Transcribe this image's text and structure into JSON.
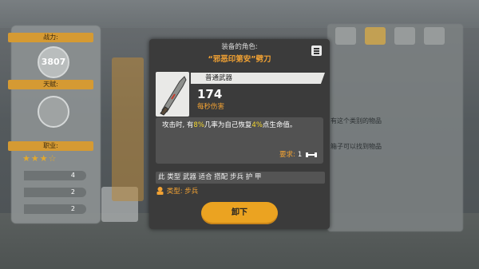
{
  "background": {
    "left_panel": {
      "power_label": "战力:",
      "power_value": "3807",
      "talent_label": "天赋:",
      "job_label": "职业:",
      "stats": [
        "4",
        "2",
        "2"
      ]
    },
    "right_text": [
      "有这个类别的物品",
      "箱子可以找到物品"
    ]
  },
  "popup": {
    "equipped_on_label": "装备的角色:",
    "item_name": "“邪恶印第安”劈刀",
    "menu_icon": "menu-icon",
    "weapon_type": "普通武器",
    "damage_value": "174",
    "damage_label": "每秒伤害",
    "description": {
      "part1": "攻击时, 有",
      "chance": "8%",
      "part2": "几率为自己恢复",
      "heal": "4%",
      "part3": "点生命值。"
    },
    "requirement_label": "要求:",
    "requirement_value": "1",
    "requirement_icon": "dumbbell-icon",
    "tags": "此 类型 武器 适合 搭配 步兵 护 甲",
    "class_label": "类型:",
    "class_value": "步兵",
    "unequip_button": "卸下"
  },
  "colors": {
    "accent": "#eba321",
    "highlight": "#f5d82e",
    "popup_bg": "#3b3b3b"
  }
}
